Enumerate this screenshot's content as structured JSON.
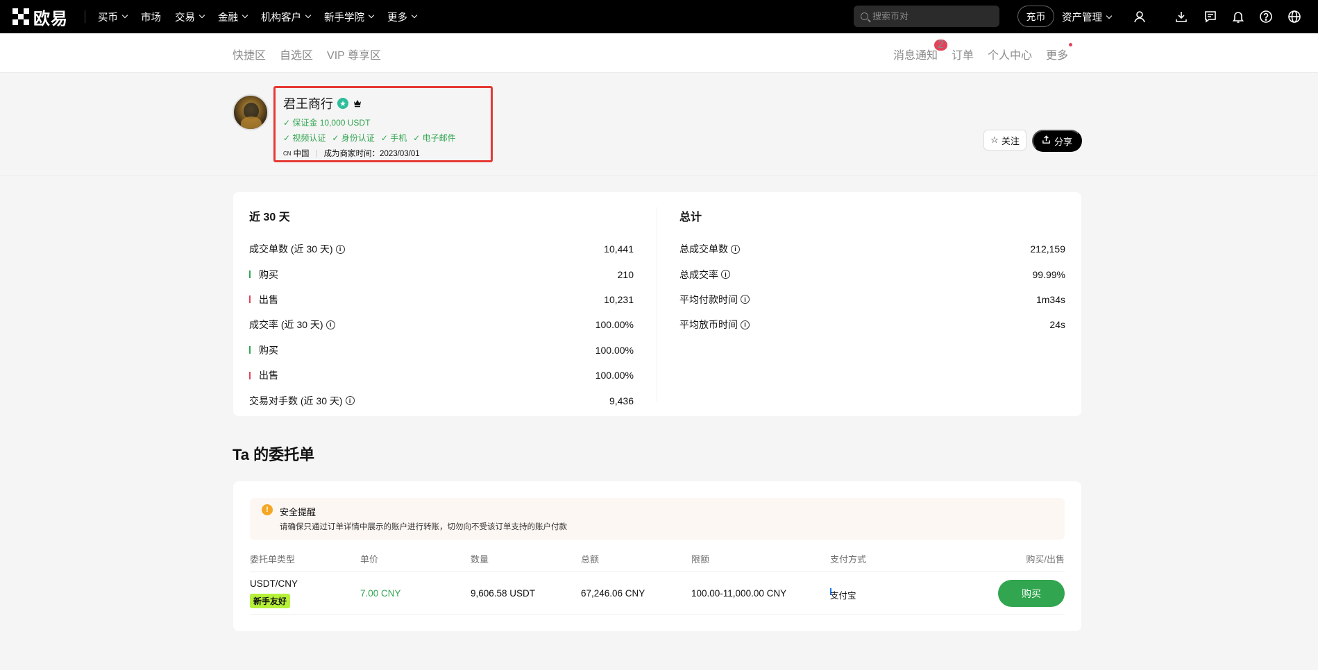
{
  "topnav": {
    "brand": "欧易",
    "links": [
      {
        "label": "买币",
        "dropdown": true
      },
      {
        "label": "市场",
        "dropdown": false
      },
      {
        "label": "交易",
        "dropdown": true
      },
      {
        "label": "金融",
        "dropdown": true
      },
      {
        "label": "机构客户",
        "dropdown": true
      },
      {
        "label": "新手学院",
        "dropdown": true
      },
      {
        "label": "更多",
        "dropdown": true
      }
    ],
    "search_placeholder": "搜索币对",
    "deposit_label": "充币",
    "asset_mgmt_label": "资产管理",
    "icons": [
      "user-icon",
      "download-icon",
      "message-icon",
      "bell-icon",
      "help-icon",
      "globe-icon"
    ]
  },
  "subnav": {
    "left": [
      "快捷区",
      "自选区",
      "VIP 尊享区"
    ],
    "right": {
      "notifications": "消息通知",
      "notifications_count": "2",
      "orders": "订单",
      "personal_center": "个人中心",
      "more": "更多"
    }
  },
  "merchant": {
    "name": "君王商行",
    "deposit": "保证金 10,000 USDT",
    "verifications": [
      "视频认证",
      "身份认证",
      "手机",
      "电子邮件"
    ],
    "region_code": "CN",
    "region": "中国",
    "since": "成为商家时间：2023/03/01",
    "follow_label": "关注",
    "share_label": "分享"
  },
  "stats": {
    "recent": {
      "title": "近 30 天",
      "rows": [
        {
          "label": "成交单数 (近 30 天)",
          "value": "10,441",
          "info": true,
          "bar": ""
        },
        {
          "label": "购买",
          "value": "210",
          "info": false,
          "bar": "green"
        },
        {
          "label": "出售",
          "value": "10,231",
          "info": false,
          "bar": "red"
        },
        {
          "label": "成交率 (近 30 天)",
          "value": "100.00%",
          "info": true,
          "bar": ""
        },
        {
          "label": "购买",
          "value": "100.00%",
          "info": false,
          "bar": "green"
        },
        {
          "label": "出售",
          "value": "100.00%",
          "info": false,
          "bar": "red"
        },
        {
          "label": "交易对手数 (近 30 天)",
          "value": "9,436",
          "info": true,
          "bar": ""
        }
      ]
    },
    "total": {
      "title": "总计",
      "rows": [
        {
          "label": "总成交单数",
          "value": "212,159",
          "info": true
        },
        {
          "label": "总成交率",
          "value": "99.99%",
          "info": true
        },
        {
          "label": "平均付款时间",
          "value": "1m34s",
          "info": true
        },
        {
          "label": "平均放币时间",
          "value": "24s",
          "info": true
        }
      ]
    }
  },
  "orders": {
    "title": "Ta 的委托单",
    "alert_title": "安全提醒",
    "alert_desc": "请确保只通过订单详情中展示的账户进行转账，切勿向不受该订单支持的账户付款",
    "headers": [
      "委托单类型",
      "单价",
      "数量",
      "总额",
      "限额",
      "支付方式",
      "购买/出售"
    ],
    "row": {
      "pair": "USDT/CNY",
      "tag": "新手友好",
      "price": "7.00 CNY",
      "quantity": "9,606.58 USDT",
      "total": "67,246.06 CNY",
      "limit": "100.00-11,000.00 CNY",
      "payment": "支付宝",
      "action": "购买"
    }
  },
  "colors": {
    "accent_green": "#31a54f",
    "alert_red": "#e53935",
    "badge_red": "#e2445c",
    "tag_lime": "#b6f13a"
  }
}
